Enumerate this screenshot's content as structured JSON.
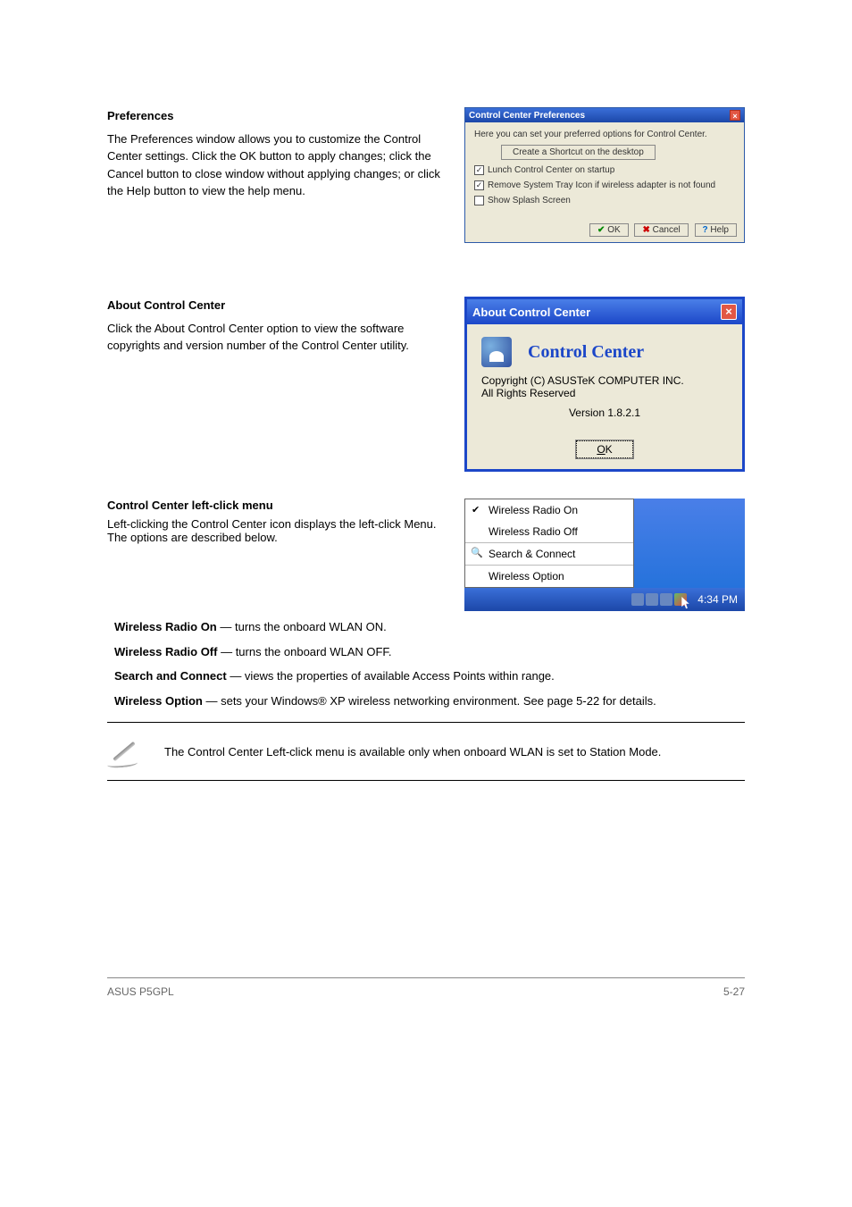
{
  "preferences": {
    "heading": "Preferences",
    "body": "The Preferences window allows you to customize the Control Center settings. Click the OK button to apply changes; click the Cancel button to close window without applying changes; or click the Help button to view the help menu.",
    "dialog": {
      "title": "Control Center Preferences",
      "intro": "Here you can set your preferred options for Control Center.",
      "shortcut_btn": "Create a Shortcut on the desktop",
      "opt1": "Lunch Control Center on startup",
      "opt2": "Remove System Tray Icon if wireless adapter is not found",
      "opt3": "Show Splash Screen",
      "ok": "OK",
      "cancel": "Cancel",
      "help": "Help"
    }
  },
  "about": {
    "heading": "About Control Center",
    "body": "Click the About Control Center option to view the software copyrights and version number of the Control Center utility.",
    "dialog": {
      "title": "About Control Center",
      "h": "Control Center",
      "copyright": "Copyright (C) ASUSTeK COMPUTER INC.",
      "rights": "All Rights Reserved",
      "version": "Version 1.8.2.1",
      "ok": "OK"
    }
  },
  "leftmenu": {
    "heading": "Control Center left-click menu",
    "intro": "Left-clicking the Control Center icon displays the left-click Menu. The options are described below.",
    "items": {
      "radio_on": {
        "label": "Wireless Radio On",
        "desc": " — turns the onboard WLAN ON."
      },
      "radio_off": {
        "label": "Wireless Radio Off",
        "desc": " — turns the onboard WLAN OFF."
      },
      "search": {
        "label": "Search and Connect",
        "desc": " — views the properties of available Access Points within range."
      },
      "option": {
        "label": "Wireless Option",
        "desc": " — sets your Windows® XP wireless networking environment. See page 5-22 for details."
      }
    },
    "tray": {
      "radio_on": "Wireless Radio On",
      "radio_off": "Wireless Radio Off",
      "search": "Search & Connect",
      "option": "Wireless Option",
      "time": "4:34 PM"
    }
  },
  "note": "The Control Center Left-click menu is available only when onboard WLAN is set to Station Mode.",
  "footer": {
    "left": "ASUS P5GPL",
    "right": "5-27"
  }
}
